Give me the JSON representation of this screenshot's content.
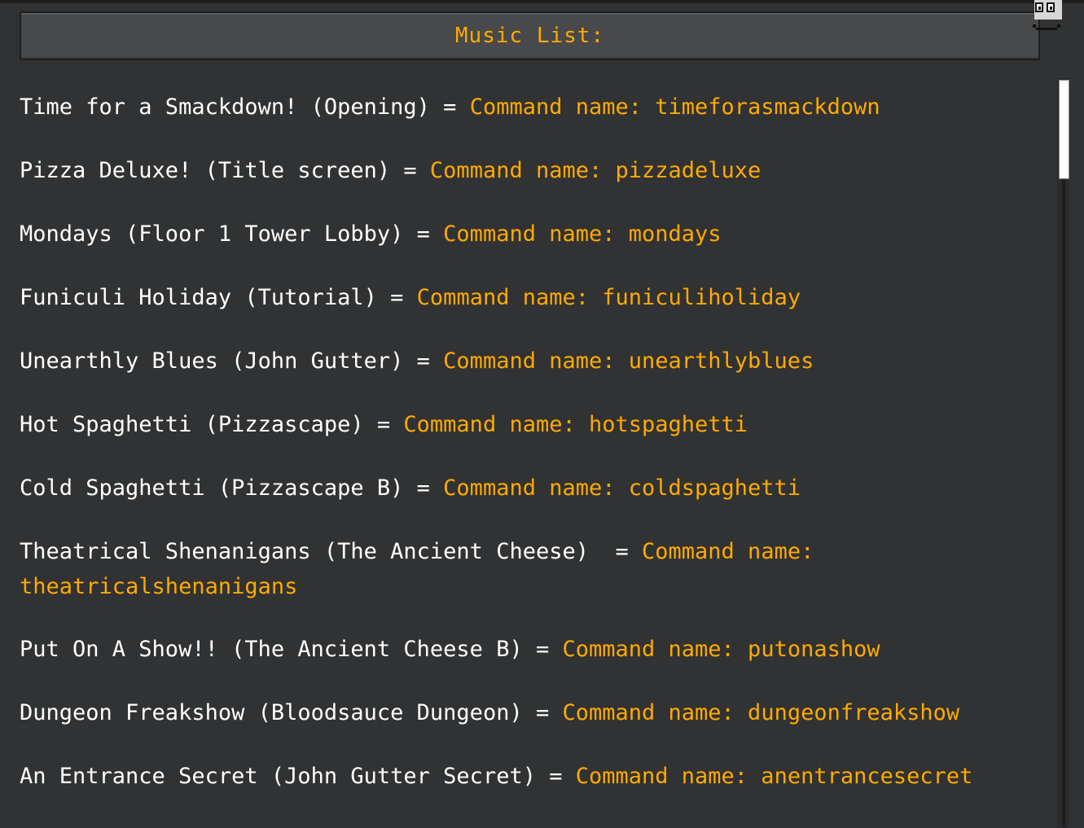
{
  "title": "Music List:",
  "entries": [
    {
      "track": "Time for a Smackdown! (Opening) = ",
      "command": "Command name: timeforasmackdown"
    },
    {
      "track": "Pizza Deluxe! (Title screen) = ",
      "command": "Command name: pizzadeluxe"
    },
    {
      "track": "Mondays (Floor 1 Tower Lobby) = ",
      "command": "Command name: mondays"
    },
    {
      "track": "Funiculi Holiday (Tutorial) = ",
      "command": "Command name: funiculiholiday"
    },
    {
      "track": "Unearthly Blues (John Gutter) = ",
      "command": "Command name: unearthlyblues"
    },
    {
      "track": "Hot Spaghetti (Pizzascape) = ",
      "command": "Command name: hotspaghetti"
    },
    {
      "track": "Cold Spaghetti (Pizzascape B) = ",
      "command": "Command name: coldspaghetti"
    },
    {
      "track": "Theatrical Shenanigans (The Ancient Cheese)  = ",
      "command": "Command name:",
      "command_cont": "theatricalshenanigans"
    },
    {
      "track": "Put On A Show!! (The Ancient Cheese B) = ",
      "command": "Command name: putonashow"
    },
    {
      "track": "Dungeon Freakshow (Bloodsauce Dungeon) = ",
      "command": "Command name: dungeonfreakshow"
    },
    {
      "track": "An Entrance Secret (John Gutter Secret) = ",
      "command": "Command name: anentrancesecret"
    }
  ],
  "icons": {
    "corner": "character-face-icon"
  },
  "colors": {
    "background": "#313233",
    "accent": "#ffaa00",
    "text": "#ffffff",
    "title_bar": "#48494a"
  }
}
